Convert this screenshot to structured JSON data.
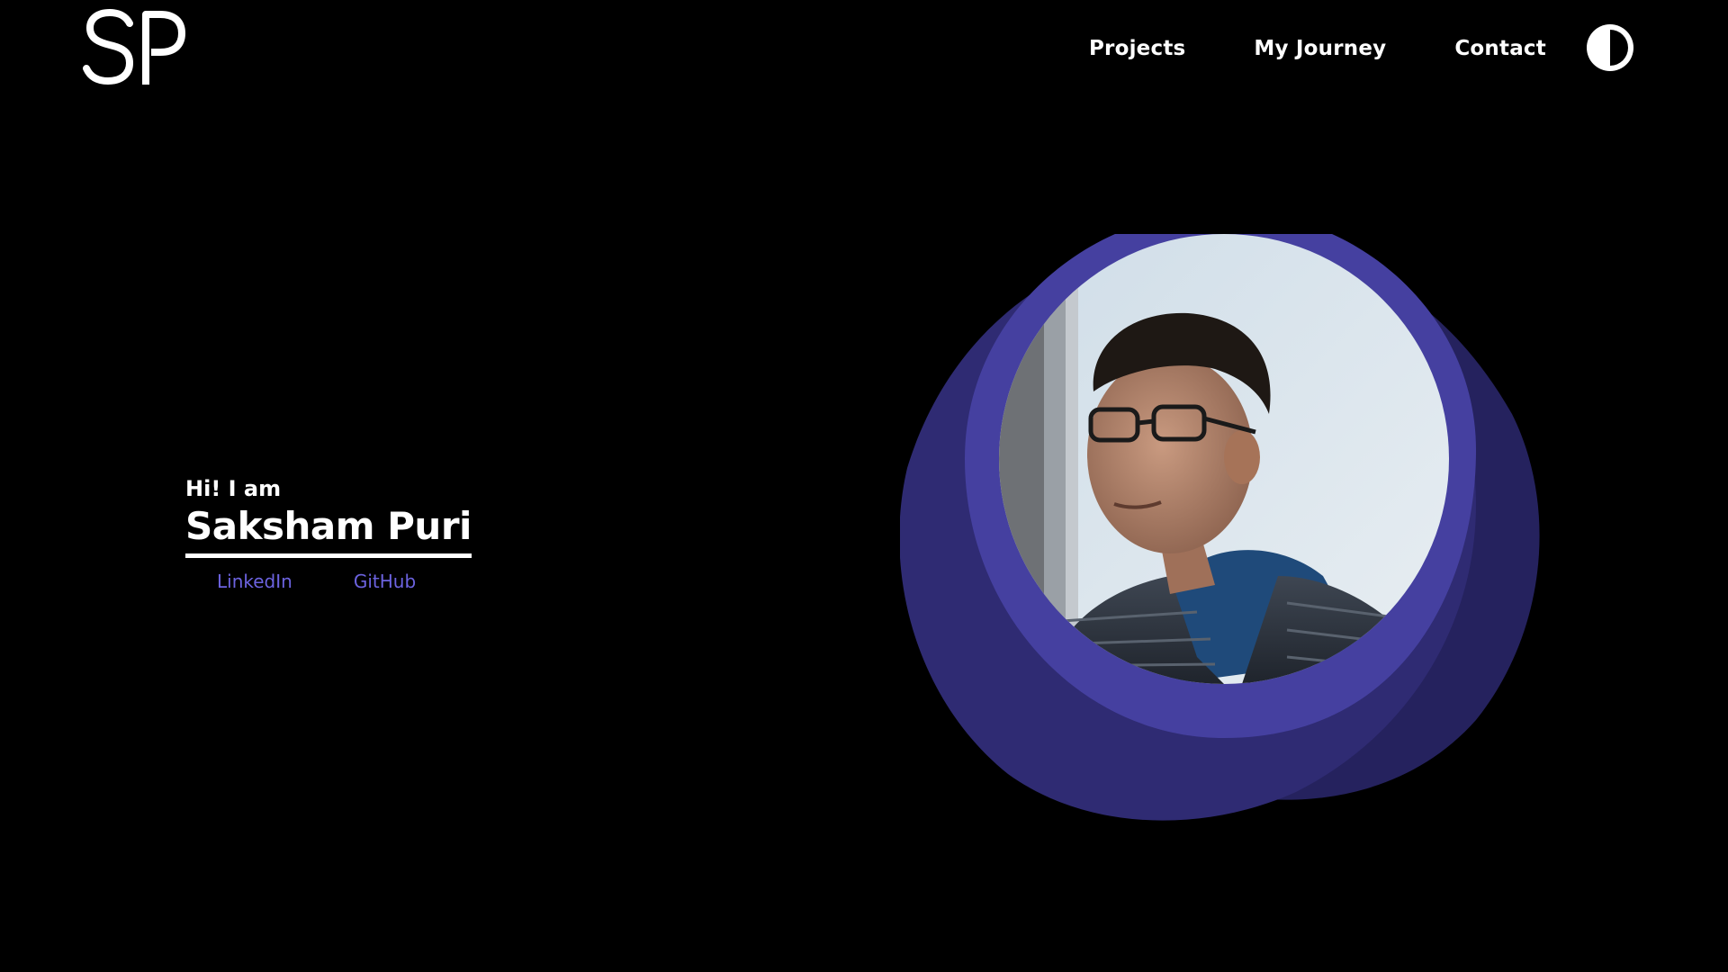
{
  "header": {
    "logo_text": "SP",
    "nav": {
      "projects": "Projects",
      "journey": "My Journey",
      "contact": "Contact"
    },
    "theme_toggle_icon": "half-circle-contrast-icon"
  },
  "hero": {
    "greeting": "Hi! I am",
    "name": "Saksham Puri",
    "links": {
      "linkedin": "LinkedIn",
      "github": "GitHub"
    }
  },
  "colors": {
    "background": "#000000",
    "text": "#ffffff",
    "link": "#6c63e0",
    "blob_outer": "#2f2b73",
    "blob_mid": "#4540a0",
    "blob_back": "#25225e"
  },
  "portrait": {
    "subject": "person-photo"
  }
}
